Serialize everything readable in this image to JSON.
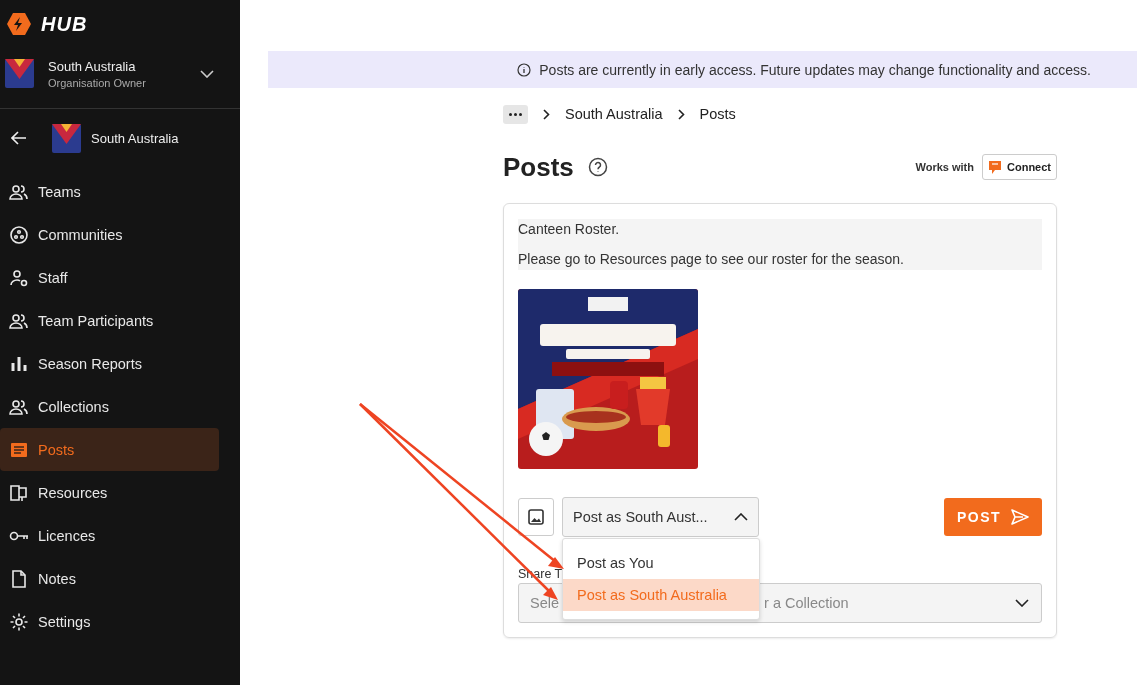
{
  "sidebar": {
    "logo": "HUB",
    "org": {
      "name": "South Australia",
      "role": "Organisation Owner"
    },
    "back_org": "South Australia",
    "items": [
      {
        "label": "Teams",
        "kind": "people",
        "selected": false
      },
      {
        "label": "Communities",
        "kind": "community",
        "selected": false
      },
      {
        "label": "Staff",
        "kind": "staff",
        "selected": false
      },
      {
        "label": "Team Participants",
        "kind": "people",
        "selected": false
      },
      {
        "label": "Season Reports",
        "kind": "chart",
        "selected": false
      },
      {
        "label": "Collections",
        "kind": "people",
        "selected": false
      },
      {
        "label": "Posts",
        "kind": "posts",
        "selected": true
      },
      {
        "label": "Resources",
        "kind": "resources",
        "selected": false
      },
      {
        "label": "Licences",
        "kind": "key",
        "selected": false
      },
      {
        "label": "Notes",
        "kind": "notes",
        "selected": false
      },
      {
        "label": "Settings",
        "kind": "settings",
        "selected": false
      }
    ]
  },
  "banner": "Posts are currently in early access. Future updates may change functionality and access.",
  "breadcrumbs": [
    "South Australia",
    "Posts"
  ],
  "page": {
    "title": "Posts",
    "works_with": "Works with",
    "connect": "Connect"
  },
  "post": {
    "lines": [
      "Canteen Roster.",
      "Please go to Resources page to see our roster for the season."
    ],
    "post_as": "Post as South Aust...",
    "post_button": "POST",
    "options": [
      {
        "label": "Post as You",
        "selected": false
      },
      {
        "label": "Post as South Australia",
        "selected": true
      }
    ],
    "share_label": "Share T",
    "share_placeholder": [
      "Sele",
      "r a Collection"
    ]
  }
}
